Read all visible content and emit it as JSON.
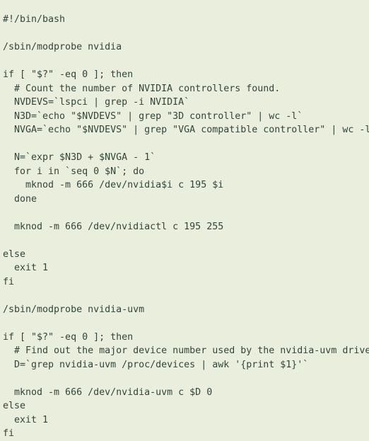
{
  "document": {
    "kind": "shell-script",
    "language": "bash",
    "interpreter": "#!/bin/bash",
    "background_color": "#eaeedc",
    "text_color": "#33453b",
    "lines": [
      "#!/bin/bash",
      "",
      "/sbin/modprobe nvidia",
      "",
      "if [ \"$?\" -eq 0 ]; then",
      "  # Count the number of NVIDIA controllers found.",
      "  NVDEVS=`lspci | grep -i NVIDIA`",
      "  N3D=`echo \"$NVDEVS\" | grep \"3D controller\" | wc -l`",
      "  NVGA=`echo \"$NVDEVS\" | grep \"VGA compatible controller\" | wc -l`",
      "",
      "  N=`expr $N3D + $NVGA - 1`",
      "  for i in `seq 0 $N`; do",
      "    mknod -m 666 /dev/nvidia$i c 195 $i",
      "  done",
      "",
      "  mknod -m 666 /dev/nvidiactl c 195 255",
      "",
      "else",
      "  exit 1",
      "fi",
      "",
      "/sbin/modprobe nvidia-uvm",
      "",
      "if [ \"$?\" -eq 0 ]; then",
      "  # Find out the major device number used by the nvidia-uvm driver",
      "  D=`grep nvidia-uvm /proc/devices | awk '{print $1}'`",
      "",
      "  mknod -m 666 /dev/nvidia-uvm c $D 0",
      "else",
      "  exit 1",
      "fi"
    ]
  }
}
